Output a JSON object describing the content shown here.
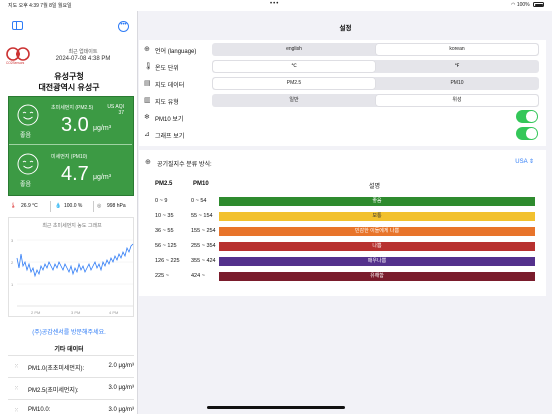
{
  "status_bar": {
    "left": "지도  오후 4:39  7월 8일 월요일",
    "dots": "•••",
    "battery": "100%"
  },
  "sidebar": {
    "logo_text": "CO2Sensors",
    "update_label": "최근 업데이트",
    "update_time": "2024-07-08 4:38 PM",
    "station_name": "유성구청",
    "station_region": "대전광역시 유성구",
    "pm25": {
      "label": "초미세먼지 (PM2.5)",
      "aqi": "US AQI\n37",
      "aqi_label": "US AQI",
      "aqi_value": "37",
      "value": "3.0",
      "unit": "μg/m³",
      "grade": "좋음"
    },
    "pm10": {
      "label": "미세먼지 (PM10)",
      "value": "4.7",
      "unit": "μg/m³",
      "grade": "좋음"
    },
    "weather": {
      "temperature": "26.9 °C",
      "humidity": "100.0 %",
      "pressure": "998 hPa"
    },
    "mini_chart": {
      "title": "최근 초미세먼지 농도 그래프",
      "y_ticks": [
        "3",
        "2",
        "1"
      ],
      "x_ticks": [
        "2 PM",
        "3 PM",
        "4 PM"
      ]
    },
    "visit_link": "(주)공감센서를 방문해주세요.",
    "other_data_title": "기타 데이터",
    "other_data": [
      {
        "label": "PM1.0(초초미세먼지):",
        "value": "2.0 μg/m³"
      },
      {
        "label": "PM2.5(초미세먼지):",
        "value": "3.0 μg/m³"
      },
      {
        "label": "PM10.0:",
        "value": "3.0 μg/m³"
      }
    ]
  },
  "main": {
    "title": "설정",
    "settings": [
      {
        "label": "언어 (language)",
        "icon": "globe-icon",
        "options": [
          "english",
          "korean"
        ],
        "selected": 1
      },
      {
        "label": "온도 단위",
        "icon": "thermometer-icon",
        "options": [
          "℃",
          "℉"
        ],
        "selected": 0
      },
      {
        "label": "지도 데이터",
        "icon": "data-icon",
        "options": [
          "PM2.5",
          "PM10"
        ],
        "selected": 0
      },
      {
        "label": "지도 유형",
        "icon": "map-icon",
        "options": [
          "일반",
          "위성"
        ],
        "selected": 1
      }
    ],
    "toggles": [
      {
        "label": "PM10 보기",
        "icon": "snowflake-icon",
        "on": true
      },
      {
        "label": "그래프 보기",
        "icon": "chart-icon",
        "on": true
      }
    ],
    "aqi_method_label": "공기질지수 분류 방식:",
    "aqi_method_value": "USA",
    "table_headers": {
      "pm25": "PM2.5",
      "pm10": "PM10",
      "desc": "설명"
    },
    "levels": [
      {
        "pm25": "0 ~ 9",
        "pm10": "0 ~ 54",
        "desc": "좋음",
        "color": "#2e8b2e"
      },
      {
        "pm25": "10 ~ 35",
        "pm10": "55 ~ 154",
        "desc": "보통",
        "color": "#f2c12e"
      },
      {
        "pm25": "36 ~ 55",
        "pm10": "155 ~ 254",
        "desc": "민감한 이들에게 나쁨",
        "color": "#e8742a"
      },
      {
        "pm25": "56 ~ 125",
        "pm10": "255 ~ 354",
        "desc": "나쁨",
        "color": "#b8312f"
      },
      {
        "pm25": "126 ~ 225",
        "pm10": "355 ~ 424",
        "desc": "매우나쁨",
        "color": "#54318c"
      },
      {
        "pm25": "225 ~",
        "pm10": "424 ~",
        "desc": "유해함",
        "color": "#7a1c2c"
      }
    ]
  }
}
